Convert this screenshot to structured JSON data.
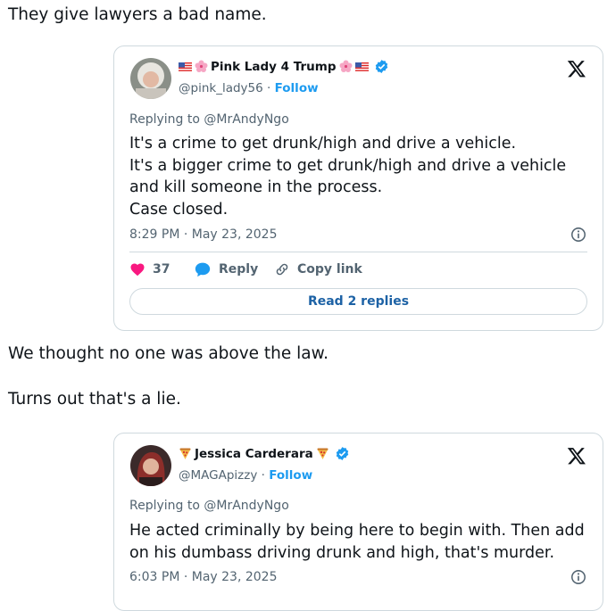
{
  "post": {
    "paragraph1": "They give lawyers a bad name.",
    "paragraph2": "We thought no one was above the law.",
    "paragraph3": "Turns out that's a lie."
  },
  "embed1": {
    "display_name": "Pink Lady 4 Trump",
    "handle": "@pink_lady56",
    "separator": "·",
    "follow": "Follow",
    "replying_to": "Replying to @MrAndyNgo",
    "body_lines": [
      "It's a crime to get drunk/high and drive a vehicle.",
      "It's a bigger crime to get drunk/high and drive a vehicle",
      "and kill someone in the process.",
      "Case closed."
    ],
    "timestamp": "8:29 PM · May 23, 2025",
    "likes": "37",
    "reply": "Reply",
    "copy_link": "Copy link",
    "read_replies": "Read 2 replies",
    "icons": [
      "flag-us-icon",
      "cherry-blossom-icon",
      "verified-badge-icon",
      "x-logo-icon",
      "info-icon",
      "heart-icon",
      "reply-bubble-icon",
      "link-icon"
    ]
  },
  "embed2": {
    "display_name": "Jessica Carderara",
    "handle": "@MAGApizzy",
    "separator": "·",
    "follow": "Follow",
    "replying_to": "Replying to @MrAndyNgo",
    "body_lines": [
      "He acted criminally by being here to begin with. Then add",
      "on his dumbass driving drunk and high, that's murder."
    ],
    "timestamp": "6:03 PM · May 23, 2025",
    "icons": [
      "pizza-icon",
      "verified-badge-icon",
      "x-logo-icon",
      "info-icon"
    ]
  },
  "colors": {
    "link_blue": "#1d9bf0",
    "read_replies_blue": "#1d62a5",
    "heart_pink": "#f91880",
    "secondary_text": "#536471",
    "border": "#cfd9de"
  }
}
